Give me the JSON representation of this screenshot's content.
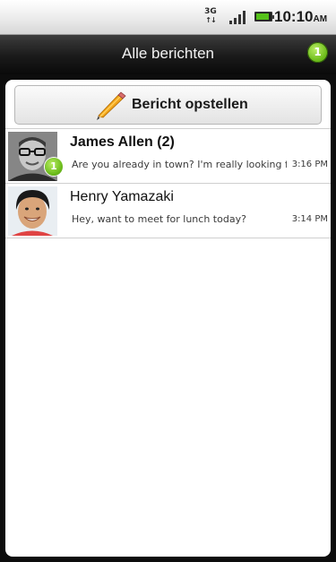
{
  "status_bar": {
    "network": "3G",
    "network_arrows": "↑↓",
    "battery_level": 0.9,
    "time": "10:10",
    "ampm": "AM"
  },
  "header": {
    "title": "Alle berichten",
    "unread_count": "1"
  },
  "compose_button": {
    "label": "Bericht opstellen",
    "icon": "pencil-icon"
  },
  "conversations": [
    {
      "name": "James Allen (2)",
      "preview": "Are you already in town? I'm really looking forward to it",
      "time": "3:16 PM",
      "unread": true,
      "unread_count": "1"
    },
    {
      "name": "Henry Yamazaki",
      "preview": "Hey, want to meet for lunch today?",
      "time": "3:14 PM",
      "unread": false
    }
  ],
  "colors": {
    "badge_green": "#6fbe1d",
    "title_bar": "#1a1a1a",
    "panel": "#ffffff"
  }
}
